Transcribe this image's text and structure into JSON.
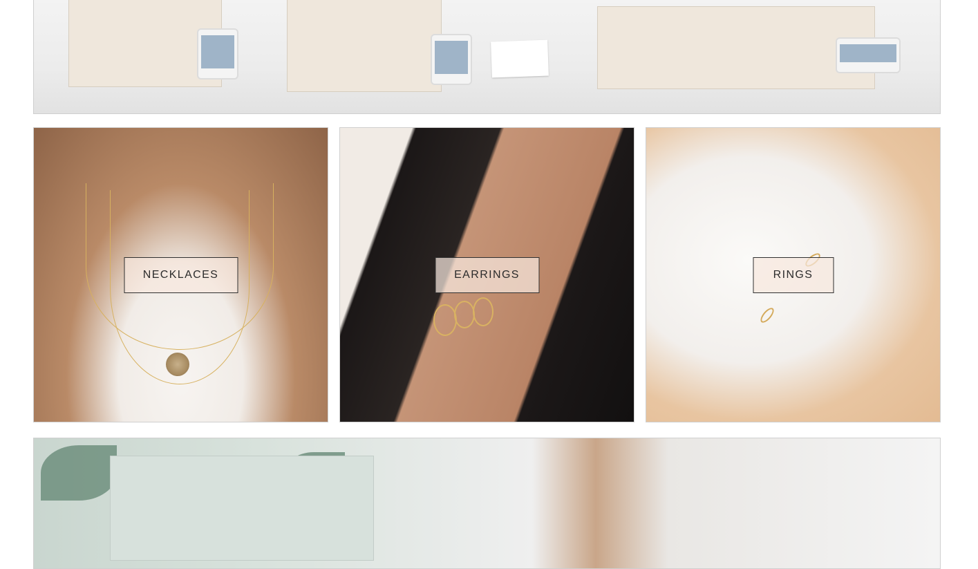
{
  "categories": {
    "necklaces": {
      "label": "NECKLACES"
    },
    "earrings": {
      "label": "EARRINGS"
    },
    "rings": {
      "label": "RINGS"
    }
  },
  "icons": {
    "hero_top": "jewelry-display-photo",
    "hero_bottom": "jewelry-tray-photo"
  }
}
